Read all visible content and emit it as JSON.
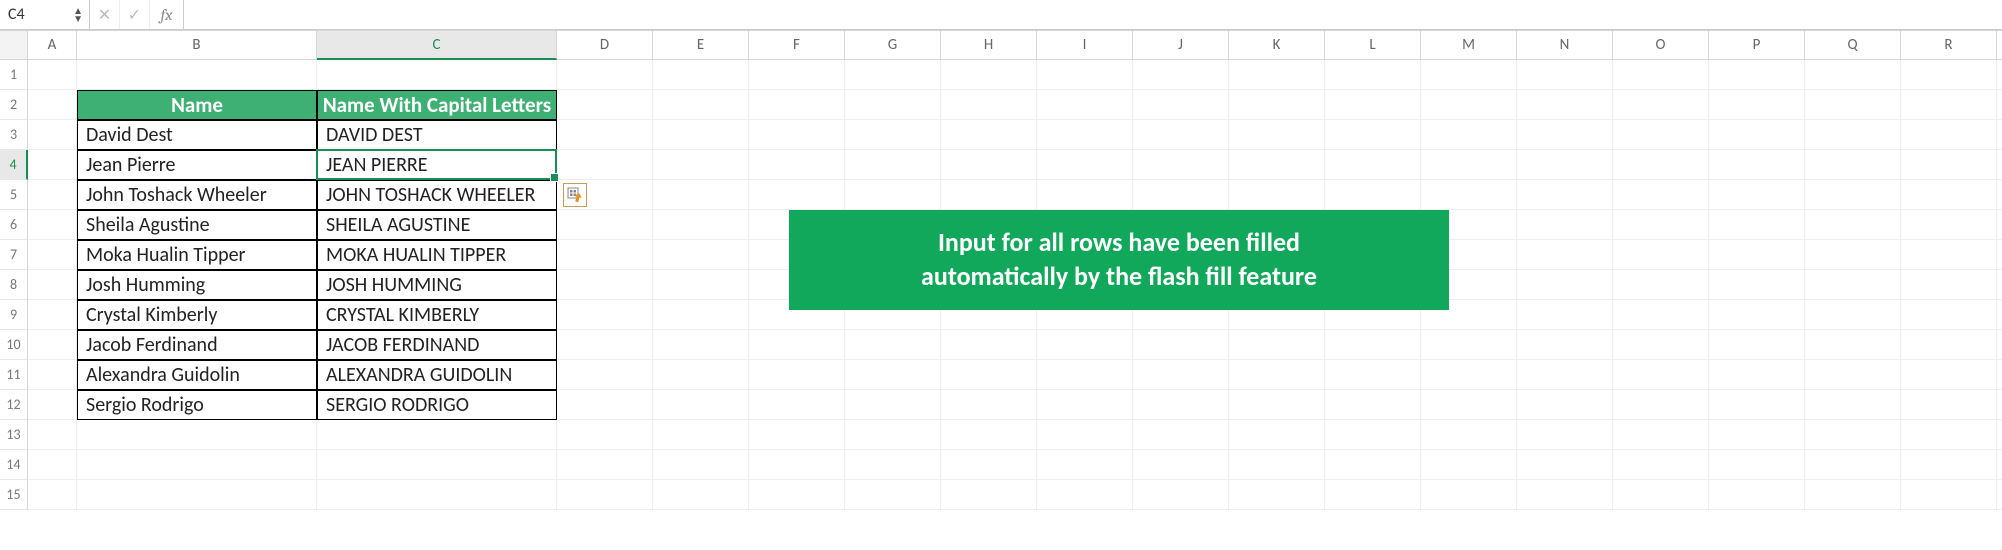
{
  "formula_bar": {
    "name_box": "C4",
    "cancel_glyph": "✕",
    "enter_glyph": "✓",
    "fx_label": "fx",
    "formula_value": ""
  },
  "columns": [
    "A",
    "B",
    "C",
    "D",
    "E",
    "F",
    "G",
    "H",
    "I",
    "J",
    "K",
    "L",
    "M",
    "N",
    "O",
    "P",
    "Q",
    "R"
  ],
  "active_col": "C",
  "active_row": 4,
  "visible_row_count": 15,
  "table": {
    "header": {
      "b": "Name",
      "c": "Name With Capital Letters"
    },
    "rows": [
      {
        "b": "David Dest",
        "c": "DAVID DEST"
      },
      {
        "b": "Jean Pierre",
        "c": "JEAN PIERRE"
      },
      {
        "b": "John Toshack Wheeler",
        "c": "JOHN TOSHACK WHEELER"
      },
      {
        "b": "Sheila Agustine",
        "c": "SHEILA AGUSTINE"
      },
      {
        "b": "Moka Hualin Tipper",
        "c": "MOKA HUALIN TIPPER"
      },
      {
        "b": "Josh Humming",
        "c": "JOSH HUMMING"
      },
      {
        "b": "Crystal Kimberly",
        "c": "CRYSTAL KIMBERLY"
      },
      {
        "b": "Jacob Ferdinand",
        "c": "JACOB FERDINAND"
      },
      {
        "b": "Alexandra Guidolin",
        "c": "ALEXANDRA GUIDOLIN"
      },
      {
        "b": "Sergio Rodrigo",
        "c": "SERGIO RODRIGO"
      }
    ]
  },
  "callout": {
    "line1": "Input for all rows have been filled",
    "line2": "automatically by the flash fill feature"
  }
}
